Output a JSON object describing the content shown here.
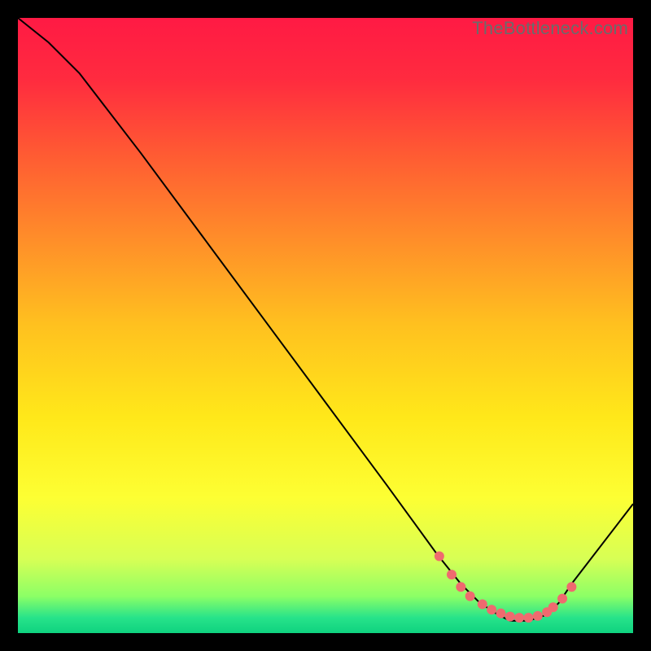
{
  "watermark": "TheBottleneck.com",
  "chart_data": {
    "type": "line",
    "title": "",
    "xlabel": "",
    "ylabel": "",
    "xlim": [
      0,
      100
    ],
    "ylim": [
      0,
      100
    ],
    "series": [
      {
        "name": "curve",
        "x": [
          0,
          5,
          10,
          20,
          30,
          40,
          50,
          60,
          68,
          72,
          75,
          78,
          80,
          83,
          86,
          88,
          90,
          100
        ],
        "y": [
          100,
          96,
          91,
          78,
          64.5,
          51,
          37.5,
          24,
          13,
          8,
          5,
          3,
          2,
          2,
          3,
          5,
          8,
          21
        ]
      }
    ],
    "markers": {
      "name": "dots",
      "x": [
        68.5,
        70.5,
        72,
        73.5,
        75.5,
        77,
        78.5,
        80,
        81.5,
        83,
        84.5,
        86,
        87,
        88.5,
        90
      ],
      "y": [
        12.5,
        9.5,
        7.5,
        6,
        4.7,
        3.8,
        3.2,
        2.7,
        2.5,
        2.5,
        2.8,
        3.4,
        4.2,
        5.6,
        7.5
      ]
    },
    "gradient_stops": [
      {
        "offset": 0.0,
        "color": "#ff1a44"
      },
      {
        "offset": 0.1,
        "color": "#ff2b3f"
      },
      {
        "offset": 0.22,
        "color": "#ff5a33"
      },
      {
        "offset": 0.35,
        "color": "#ff8a2a"
      },
      {
        "offset": 0.5,
        "color": "#ffc11f"
      },
      {
        "offset": 0.65,
        "color": "#ffe81a"
      },
      {
        "offset": 0.78,
        "color": "#fdff33"
      },
      {
        "offset": 0.88,
        "color": "#d7ff55"
      },
      {
        "offset": 0.94,
        "color": "#8cff66"
      },
      {
        "offset": 0.975,
        "color": "#27e38a"
      },
      {
        "offset": 1.0,
        "color": "#0fd27f"
      }
    ],
    "marker_color": "#ef6a6f",
    "line_color": "#000000"
  }
}
